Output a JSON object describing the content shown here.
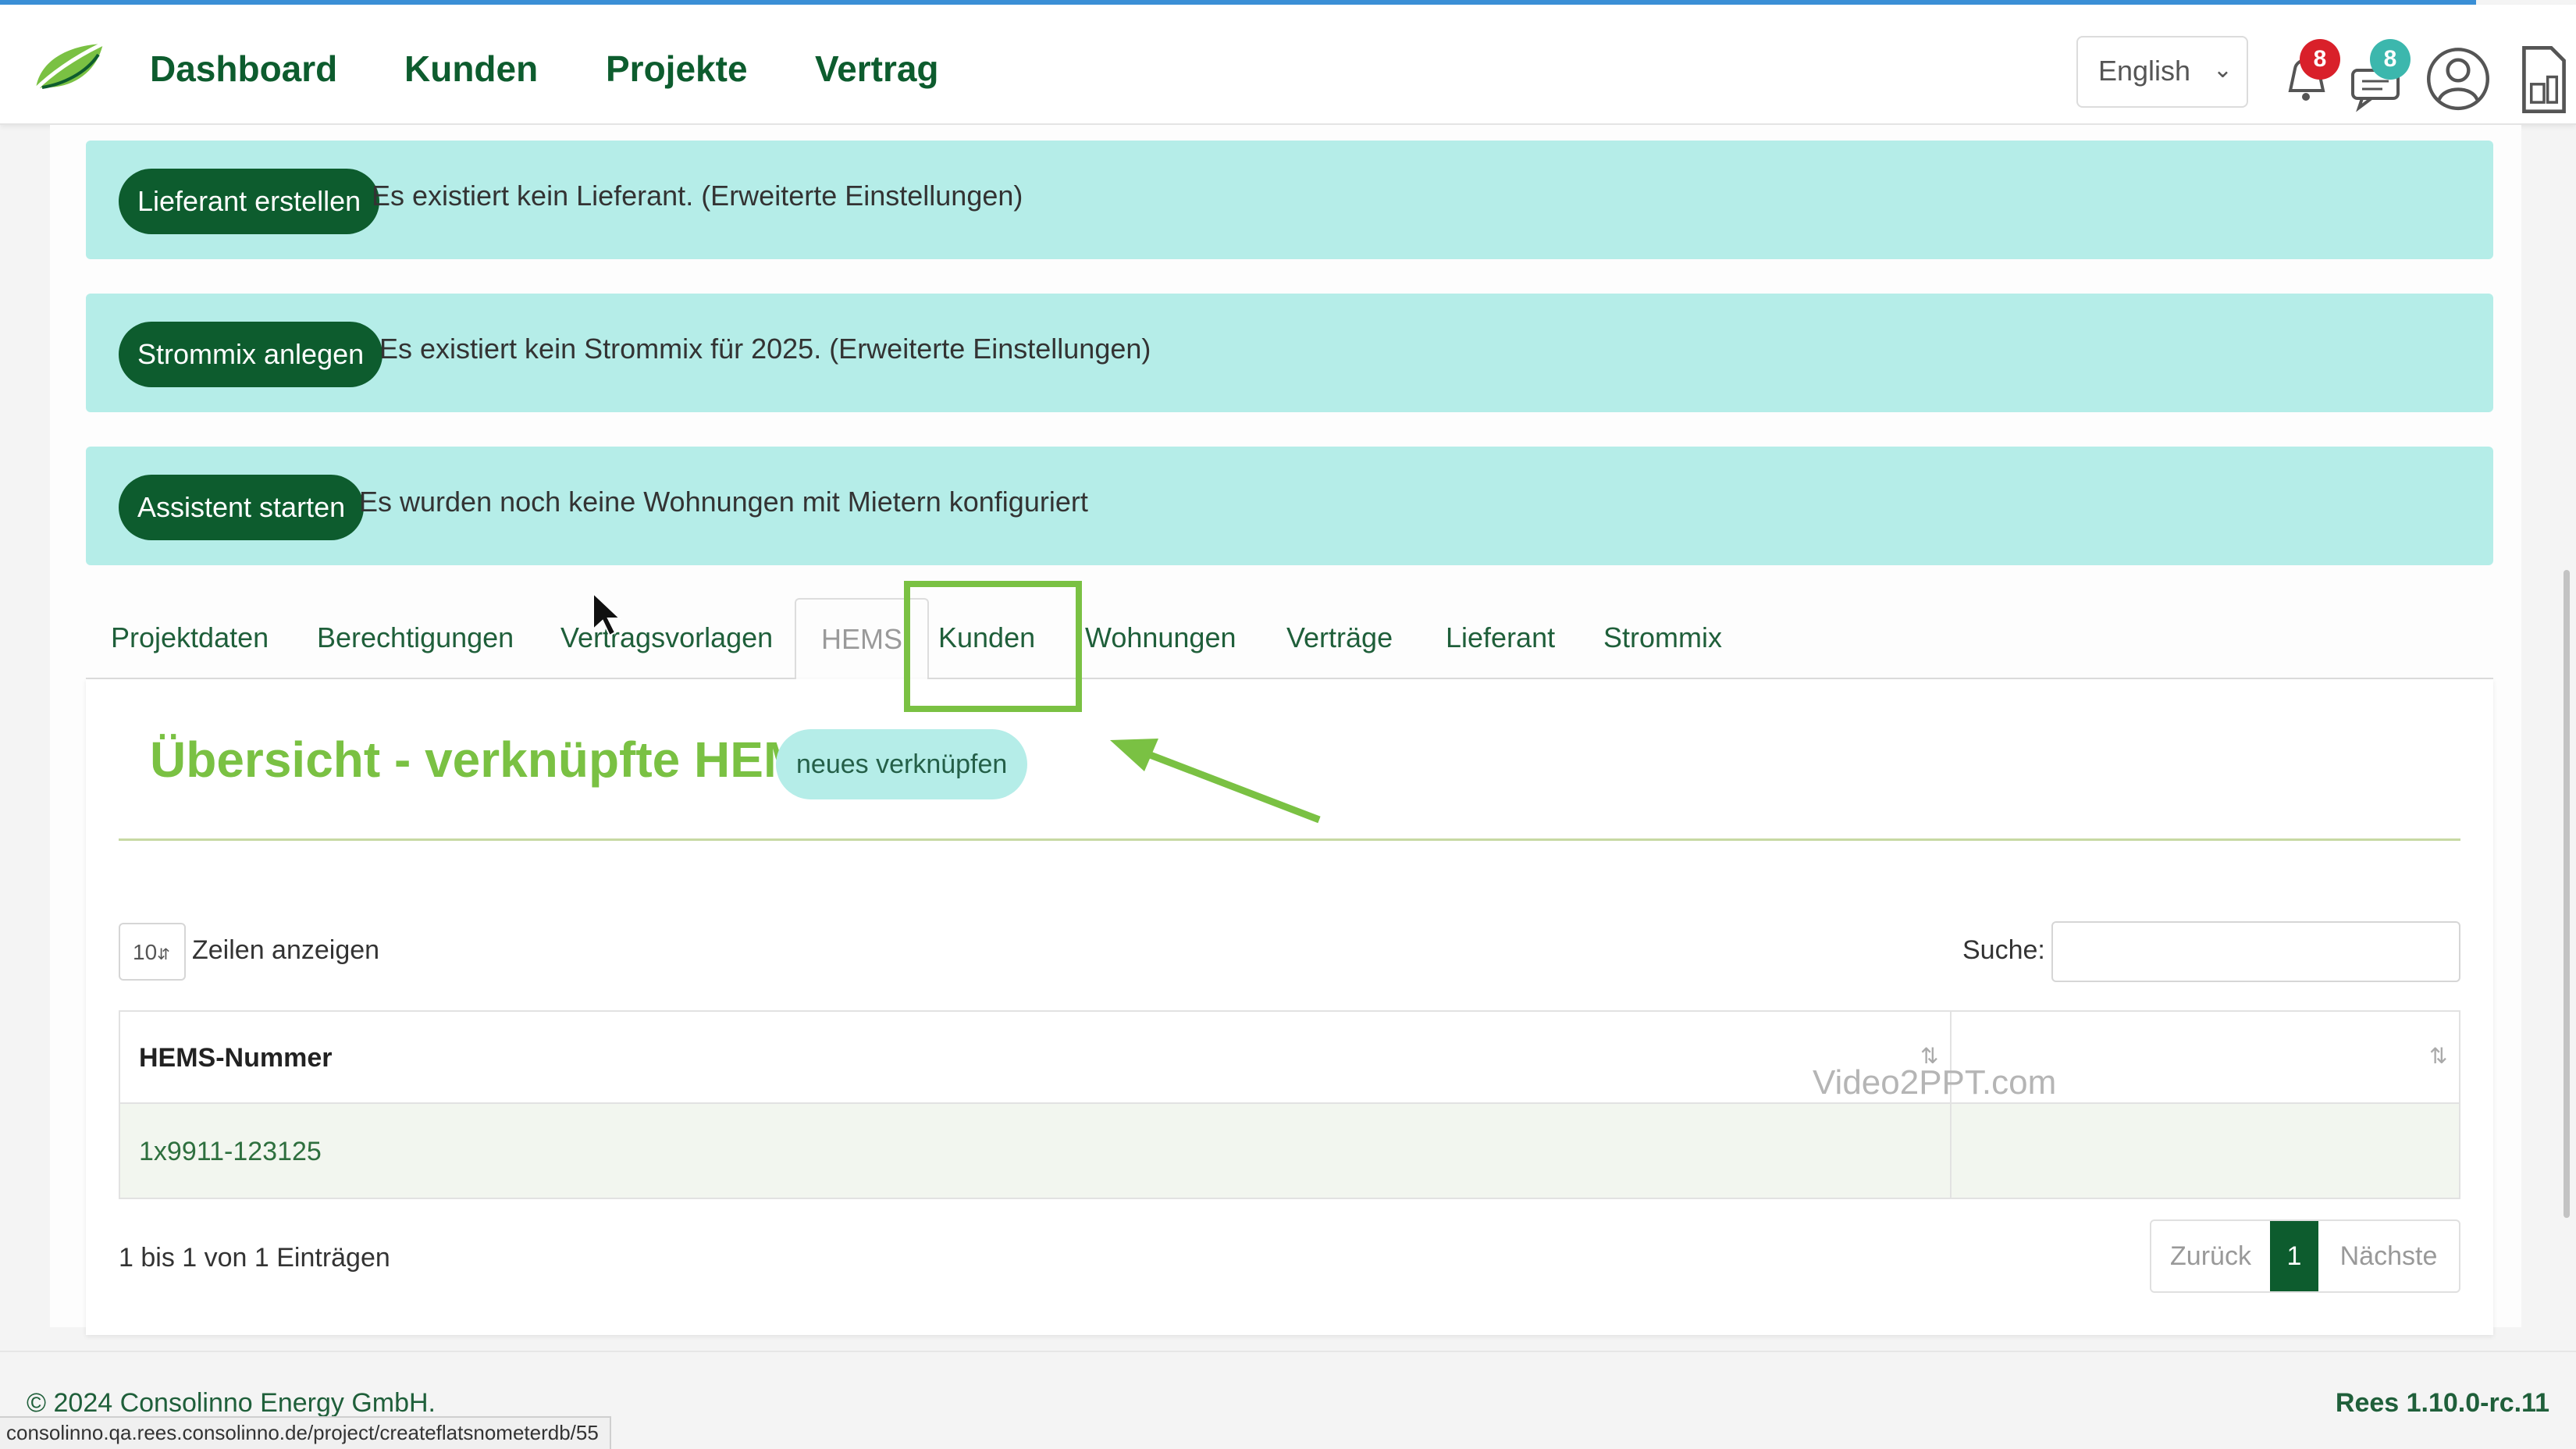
{
  "nav": {
    "items": [
      "Dashboard",
      "Kunden",
      "Projekte",
      "Vertrag"
    ],
    "language": "English",
    "notifications_count": "8",
    "messages_count": "8"
  },
  "alerts": [
    {
      "button": "Lieferant erstellen",
      "message": "Es existiert kein Lieferant. (Erweiterte Einstellungen)"
    },
    {
      "button": "Strommix anlegen",
      "message": "Es existiert kein Strommix für 2025. (Erweiterte Einstellungen)"
    },
    {
      "button": "Assistent starten",
      "message": "Es wurden noch keine Wohnungen mit Mietern konfiguriert"
    }
  ],
  "tabs": [
    "Projektdaten",
    "Berechtigungen",
    "Vertragsvorlagen",
    "HEMS",
    "Kunden",
    "Wohnungen",
    "Verträge",
    "Lieferant",
    "Strommix"
  ],
  "panel": {
    "title": "Übersicht - verknüpfte HEMS",
    "link_button": "neues verknüpfen",
    "length_value": "10",
    "length_label": "Zeilen anzeigen",
    "search_label": "Suche:",
    "search_value": "",
    "columns": [
      "HEMS-Nummer",
      ""
    ],
    "rows": [
      [
        "1x9911-123125",
        ""
      ]
    ],
    "info": "1 bis 1 von 1 Einträgen",
    "pager": {
      "prev": "Zurück",
      "current": "1",
      "next": "Nächste"
    }
  },
  "watermark": "Video2PPT.com",
  "footer": {
    "copyright": "© 2024 Consolinno Energy GmbH.",
    "version": "Rees 1.10.0-rc.11",
    "status_url": "consolinno.qa.rees.consolinno.de/project/createflatsnometerdb/55"
  },
  "colors": {
    "brand_dark": "#0d5c2e",
    "accent_green": "#7ac143",
    "alert_bg": "#b5ede8",
    "badge_red": "#d9202a",
    "badge_teal": "#3cb7ad"
  },
  "icons": [
    "leaf-logo-icon",
    "chevron-down-icon",
    "bell-icon",
    "chat-icon",
    "user-circle-icon",
    "document-icon",
    "sort-icon",
    "mouse-cursor-icon",
    "annotation-arrow-icon"
  ]
}
